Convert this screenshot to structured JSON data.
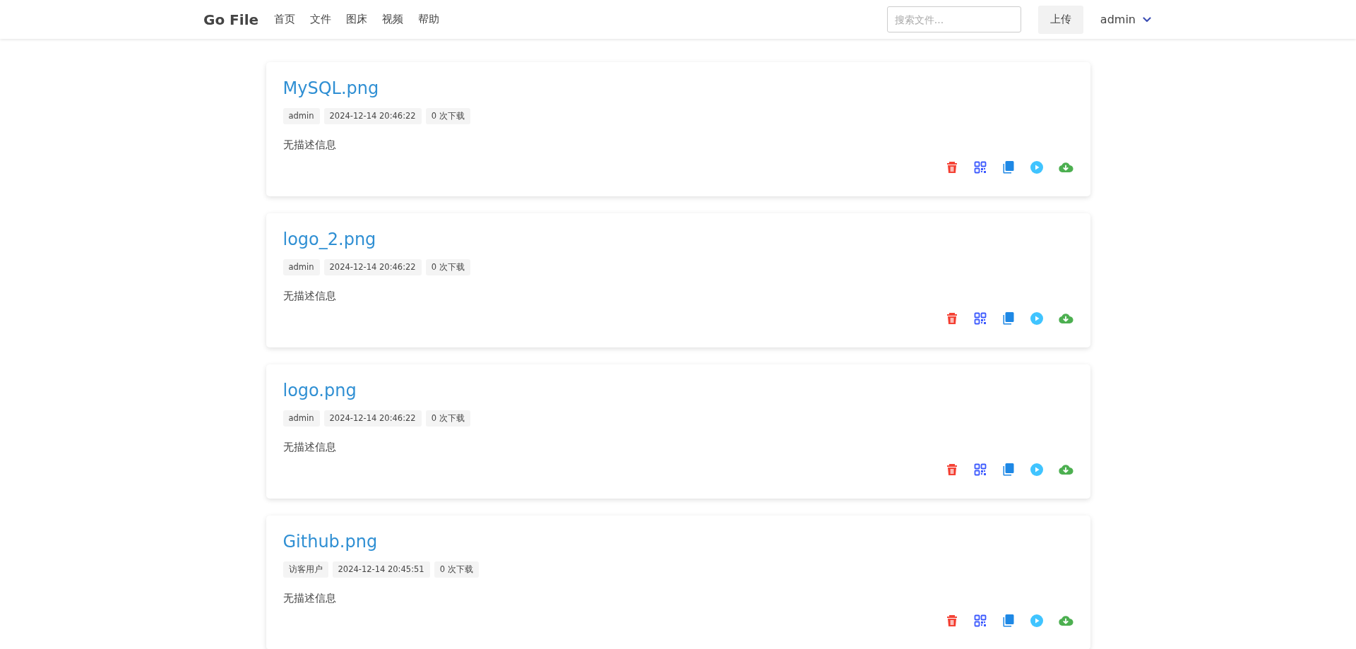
{
  "navbar": {
    "logo": "Go File",
    "links": [
      "首页",
      "文件",
      "图床",
      "视频",
      "帮助"
    ],
    "search": {
      "placeholder": "搜索文件..."
    },
    "upload_button": "上传",
    "user": "admin"
  },
  "files": [
    {
      "name": "MySQL.png",
      "uploader": "admin",
      "time": "2024-12-14 20:46:22",
      "downloads": "0 次下载",
      "description": "无描述信息"
    },
    {
      "name": "logo_2.png",
      "uploader": "admin",
      "time": "2024-12-14 20:46:22",
      "downloads": "0 次下载",
      "description": "无描述信息"
    },
    {
      "name": "logo.png",
      "uploader": "admin",
      "time": "2024-12-14 20:46:22",
      "downloads": "0 次下载",
      "description": "无描述信息"
    },
    {
      "name": "Github.png",
      "uploader": "访客用户",
      "time": "2024-12-14 20:45:51",
      "downloads": "0 次下载",
      "description": "无描述信息"
    }
  ]
}
